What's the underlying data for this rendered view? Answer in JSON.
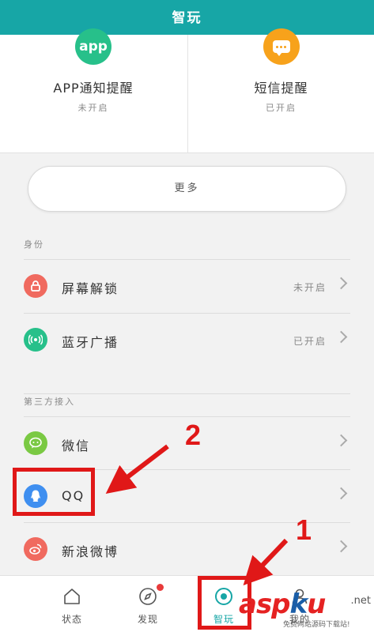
{
  "header": {
    "title": "智玩"
  },
  "cards": [
    {
      "icon": "app",
      "name": "APP通知提醒",
      "status": "未开启"
    },
    {
      "icon": "message-icon",
      "name": "短信提醒",
      "status": "已开启"
    }
  ],
  "more_label": "更多",
  "sections": {
    "identity": {
      "label": "身份",
      "items": [
        {
          "label": "屏幕解锁",
          "value": "未开启",
          "icon": "lock-icon",
          "color": "#f06a5f"
        },
        {
          "label": "蓝牙广播",
          "value": "已开启",
          "icon": "broadcast-icon",
          "color": "#27c08a"
        }
      ]
    },
    "third_party": {
      "label": "第三方接入",
      "items": [
        {
          "label": "微信",
          "icon": "wechat-icon",
          "color": "#7ac943"
        },
        {
          "label": "QQ",
          "icon": "qq-icon",
          "color": "#3f8ff0"
        },
        {
          "label": "新浪微博",
          "icon": "weibo-icon",
          "color": "#f06a5f"
        }
      ]
    }
  },
  "annotations": {
    "step1": "1",
    "step2": "2"
  },
  "tabbar": {
    "tabs": [
      {
        "label": "状态",
        "icon": "home-icon"
      },
      {
        "label": "发现",
        "icon": "compass-icon"
      },
      {
        "label": "智玩",
        "icon": "smart-play-icon",
        "active": true
      },
      {
        "label": "我的",
        "icon": "profile-icon"
      }
    ]
  },
  "watermark": {
    "brand_asp": "asp",
    "brand_k": "k",
    "brand_u": "u",
    "suffix": ".net",
    "subtitle": "免费网站源码下载站!"
  },
  "colors": {
    "accent": "#17a6a6",
    "annotation": "#e01818"
  }
}
